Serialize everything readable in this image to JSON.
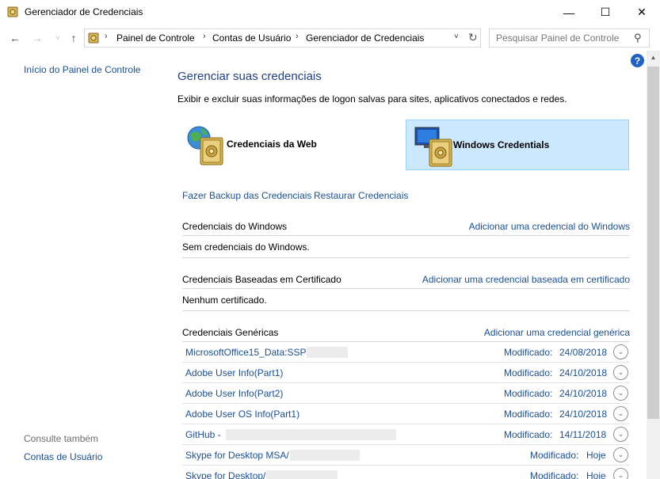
{
  "window": {
    "title": "Gerenciador de Credenciais",
    "min_glyph": "—",
    "max_glyph": "☐",
    "close_glyph": "✕"
  },
  "nav": {
    "back_glyph": "←",
    "forward_glyph": "→",
    "recent_glyph": "˅",
    "up_glyph": "↑"
  },
  "address": {
    "crumbs": [
      "Painel de Controle",
      "Contas de Usuário",
      "Gerenciador de Credenciais"
    ],
    "separator": "›",
    "dropdown_glyph": "˅",
    "refresh_glyph": "↻"
  },
  "search": {
    "placeholder": "Pesquisar Painel de Controle",
    "icon": "⚲"
  },
  "help": {
    "glyph": "?"
  },
  "sidebar": {
    "home": "Início do Painel de Controle",
    "see_also": "Consulte também",
    "user_accounts": "Contas de Usuário"
  },
  "main": {
    "title": "Gerenciar suas credenciais",
    "description": "Exibir e excluir suas informações de logon salvas para sites, aplicativos conectados e redes.",
    "tiles": {
      "web": "Credenciais da Web",
      "windows": "Windows Credentials"
    },
    "backup": "Fazer Backup das Credenciais",
    "restore": "Restaurar Credenciais"
  },
  "sections": {
    "windows": {
      "header": "Credenciais do Windows",
      "add": "Adicionar uma credencial do Windows",
      "empty": "Sem credenciais do Windows."
    },
    "certificate": {
      "header": "Credenciais Baseadas em Certificado",
      "add": "Adicionar uma credencial baseada em certificado",
      "empty": "Nenhum certificado."
    },
    "generic": {
      "header": "Credenciais Genéricas",
      "add": "Adicionar uma credencial genérica"
    }
  },
  "generic_credentials": [
    {
      "name": "MicrosoftOffice15_Data:SSPI:",
      "modified_label": "Modificado:",
      "modified": "24/08/2018"
    },
    {
      "name": "Adobe User Info(Part1)",
      "modified_label": "Modificado:",
      "modified": "24/10/2018"
    },
    {
      "name": "Adobe User Info(Part2)",
      "modified_label": "Modificado:",
      "modified": "24/10/2018"
    },
    {
      "name": "Adobe User OS Info(Part1)",
      "modified_label": "Modificado:",
      "modified": "24/10/2018"
    },
    {
      "name": "GitHub -",
      "modified_label": "Modificado:",
      "modified": "14/11/2018"
    },
    {
      "name": "Skype for Desktop MSA/",
      "modified_label": "Modificado:",
      "modified": "Hoje"
    },
    {
      "name": "Skype for Desktop/",
      "modified_label": "Modificado:",
      "modified": "Hoje"
    }
  ],
  "expand_glyph": "⌄",
  "colors": {
    "link": "#1a4f9c",
    "title": "#1e3f8a",
    "selected_tile": "#cce8ff",
    "help": "#1e63c4"
  }
}
